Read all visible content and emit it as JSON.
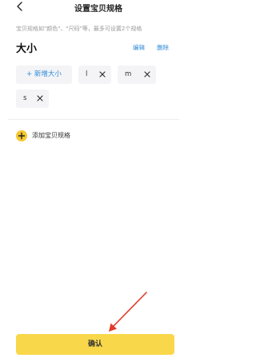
{
  "header": {
    "title": "设置宝贝规格",
    "back_icon": "chevron-left-icon"
  },
  "hint": "宝贝规格如\"颜色\"、\"尺码\"等，最多可设置2个规格",
  "spec": {
    "name": "大小",
    "edit_label": "编辑",
    "delete_label": "删除",
    "add_value_label": "+ 新增大小",
    "values": [
      "l",
      "m",
      "s"
    ]
  },
  "add_spec": {
    "label": "添加宝贝规格",
    "icon": "plus-circle-icon"
  },
  "confirm_label": "确认",
  "colors": {
    "accent_blue": "#2f8bd8",
    "button_yellow": "#f9d74a",
    "annotation_red": "#e23a2a"
  }
}
